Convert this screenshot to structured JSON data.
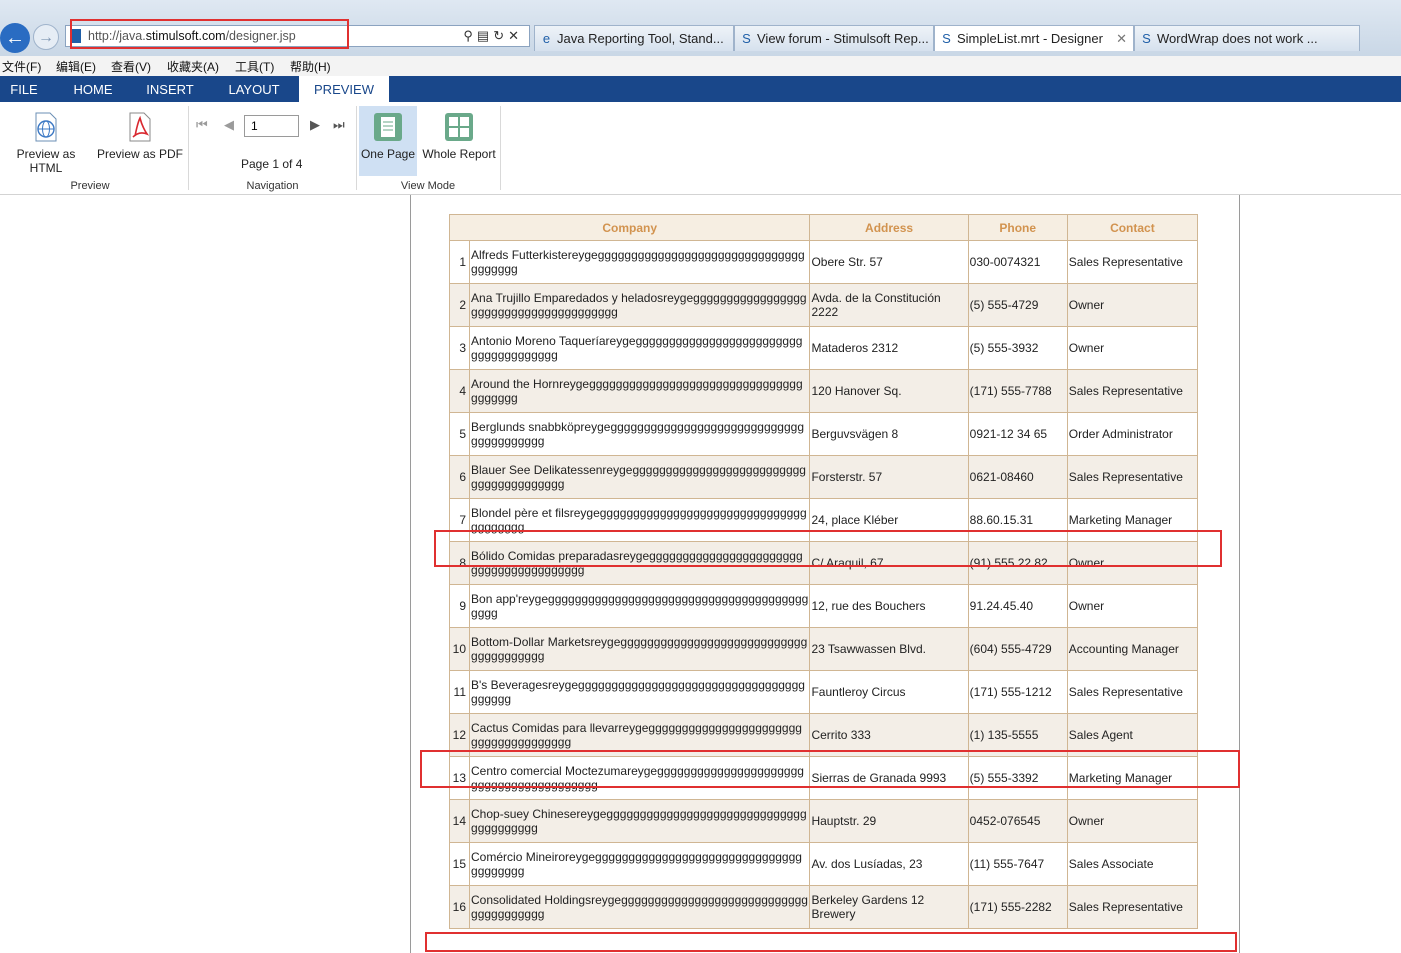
{
  "browser": {
    "url_prefix": "http://java.",
    "url_domain": "stimulsoft.com",
    "url_path": "/designer.jsp",
    "tabs": [
      {
        "title": "Java Reporting Tool, Stand..."
      },
      {
        "title": "View forum - Stimulsoft Rep..."
      },
      {
        "title": "SimpleList.mrt - Designer"
      },
      {
        "title": "WordWrap does not work ..."
      }
    ],
    "menu": [
      "文件(F)",
      "编辑(E)",
      "查看(V)",
      "收藏夹(A)",
      "工具(T)",
      "帮助(H)"
    ]
  },
  "ribbon": {
    "tabs": [
      "FILE",
      "HOME",
      "INSERT",
      "LAYOUT",
      "PREVIEW"
    ],
    "preview_html": "Preview as HTML",
    "preview_pdf": "Preview as PDF",
    "group_preview": "Preview",
    "page_input": "1",
    "page_count": "Page 1 of 4",
    "group_navigation": "Navigation",
    "one_page": "One Page",
    "whole_report": "Whole Report",
    "group_viewmode": "View Mode"
  },
  "report": {
    "headers": [
      "Company",
      "Address",
      "Phone",
      "Contact"
    ],
    "rows": [
      {
        "n": "1",
        "company": "Alfreds Futterkistereygegggggggggggggggggggggggggggggggggggggg",
        "address": "Obere Str. 57",
        "phone": "030-0074321",
        "contact": "Sales Representative"
      },
      {
        "n": "2",
        "company": "Ana Trujillo Emparedados y heladosreygeggggggggggggggggggggggggggggggggggggggg",
        "address": "Avda. de la Constitución 2222",
        "phone": "(5) 555-4729",
        "contact": "Owner"
      },
      {
        "n": "3",
        "company": "Antonio Moreno Taqueríareygegggggggggggggggggggggggggggggggggggggg",
        "address": "Mataderos 2312",
        "phone": "(5) 555-3932",
        "contact": "Owner"
      },
      {
        "n": "4",
        "company": "Around the Hornreygeggggggggggggggggggggggggggggggggggggggg",
        "address": "120 Hanover Sq.",
        "phone": "(171) 555-7788",
        "contact": "Sales Representative"
      },
      {
        "n": "5",
        "company": "Berglunds snabbköpreygegggggggggggggggggggggggggggggggggggggggg",
        "address": "Berguvsvägen 8",
        "phone": "0921-12 34 65",
        "contact": "Order Administrator"
      },
      {
        "n": "6",
        "company": "Blauer See Delikatessenreygegggggggggggggggggggggggggggggggggggggggg",
        "address": "Forsterstr. 57",
        "phone": "0621-08460",
        "contact": "Sales Representative"
      },
      {
        "n": "7",
        "company": "Blondel père et filsreygeggggggggggggggggggggggggggggggggggggggg",
        "address": "24, place Kléber",
        "phone": "88.60.15.31",
        "contact": "Marketing Manager"
      },
      {
        "n": "8",
        "company": "Bólido Comidas preparadasreygegggggggggggggggggggggggggggggggggggggggg",
        "address": "C/ Araquil, 67",
        "phone": "(91) 555 22 82",
        "contact": "Owner"
      },
      {
        "n": "9",
        "company": "Bon app'reygeggggggggggggggggggggggggggggggggggggggggggg",
        "address": "12, rue des Bouchers",
        "phone": "91.24.45.40",
        "contact": "Owner"
      },
      {
        "n": "10",
        "company": "Bottom-Dollar Marketsreygeggggggggggggggggggggggggggggggggggggggg",
        "address": "23 Tsawwassen Blvd.",
        "phone": "(604) 555-4729",
        "contact": "Accounting Manager"
      },
      {
        "n": "11",
        "company": "B's Beveragesreygegggggggggggggggggggggggggggggggggggggggg",
        "address": "Fauntleroy Circus",
        "phone": "(171) 555-1212",
        "contact": "Sales Representative"
      },
      {
        "n": "12",
        "company": "Cactus Comidas para llevarreygegggggggggggggggggggggggggggggggggggggg",
        "address": "Cerrito 333",
        "phone": "(1) 135-5555",
        "contact": "Sales Agent"
      },
      {
        "n": "13",
        "company": "Centro comercial Moctezumareygeggggggggggggggggggggggggggggggggggggggggg",
        "address": "Sierras de Granada 9993",
        "phone": "(5) 555-3392",
        "contact": "Marketing Manager"
      },
      {
        "n": "14",
        "company": "Chop-suey Chinesereygegggggggggggggggggggggggggggggggggggggggg",
        "address": "Hauptstr. 29",
        "phone": "0452-076545",
        "contact": "Owner"
      },
      {
        "n": "15",
        "company": "Comércio Mineiroreygeggggggggggggggggggggggggggggggggggggggg",
        "address": "Av. dos Lusíadas, 23",
        "phone": "(11) 555-7647",
        "contact": "Sales Associate"
      },
      {
        "n": "16",
        "company": "Consolidated Holdingsreygeggggggggggggggggggggggggggggggggggggggg",
        "address": "Berkeley Gardens 12 Brewery",
        "phone": "(171) 555-2282",
        "contact": "Sales Representative"
      }
    ]
  }
}
